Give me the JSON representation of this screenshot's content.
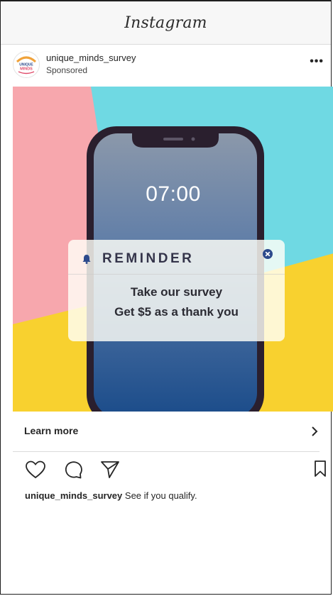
{
  "app": {
    "title": "Instagram"
  },
  "post": {
    "username": "unique_minds_survey",
    "sponsored_label": "Sponsored",
    "avatar_text": "UNIQUE MINDS",
    "more_label": "•••"
  },
  "ad": {
    "time": "07:00",
    "reminder_title": "REMINDER",
    "line1": "Take our survey",
    "line2": "Get $5 as a thank you"
  },
  "cta": {
    "label": "Learn more"
  },
  "caption": {
    "username": "unique_minds_survey",
    "text": "See if you qualify."
  },
  "icons": {
    "like": "heart-icon",
    "comment": "comment-icon",
    "share": "send-icon",
    "save": "bookmark-icon"
  },
  "colors": {
    "bg_pink": "#f7a7ad",
    "bg_teal": "#6fd9e3",
    "bg_yellow": "#f8d12f",
    "phone_frame": "#2a1f2e",
    "screen_top": "#7f8ea3",
    "screen_bottom": "#1b4c8a",
    "accent_navy": "#2c4a8c"
  }
}
